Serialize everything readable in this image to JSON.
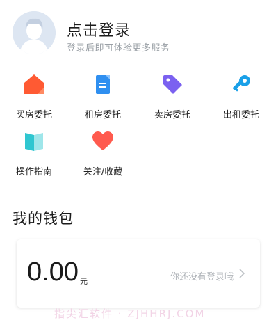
{
  "profile": {
    "login_title": "点击登录",
    "login_subtitle": "登录后即可体验更多服务"
  },
  "services": [
    {
      "label": "买房委托",
      "icon": "house-icon"
    },
    {
      "label": "租房委托",
      "icon": "document-icon"
    },
    {
      "label": "卖房委托",
      "icon": "price-tag-icon"
    },
    {
      "label": "出租委托",
      "icon": "key-icon"
    },
    {
      "label": "操作指南",
      "icon": "book-icon"
    },
    {
      "label": "关注/收藏",
      "icon": "heart-icon"
    }
  ],
  "wallet": {
    "title": "我的钱包",
    "amount": "0.00",
    "unit": "元",
    "hint": "你还没有登录哦"
  },
  "watermark": "指尖汇软件 · ZJHHRJ.COM",
  "colors": {
    "house": "#ff5a33",
    "document": "#2f8ff0",
    "tag": "#7b61f0",
    "key": "#1aa0e8",
    "book": "#2fc6d0",
    "heart": "#ff5a4e"
  }
}
